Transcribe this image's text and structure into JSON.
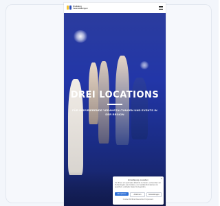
{
  "header": {
    "logo_text": "Dreiklang Veranstaltungen"
  },
  "hero": {
    "title": "DREI LOCATIONS",
    "subtitle": "FÜR INSPIRIERENDE VERANSTALTUNGEN UND EVENTS IN DER REGION"
  },
  "consent": {
    "title": "Einwilligung verwalten",
    "body": "Um Ihnen ein optimales Erlebnis zu bieten, verwenden wir Technologien wie Cookies, um Geräteinformationen zu speichern und/oder darauf zuzugreifen.",
    "accept_label": "Akzeptieren",
    "deny_label": "Ablehnen",
    "prefs_label": "Einstellungen",
    "links": "Cookie-Richtlinie  Datenschutz  Impressum"
  },
  "colors": {
    "hero_blue": "#2236a8",
    "accent_blue": "#2c6fd6",
    "logo_yellow": "#f2c12e",
    "logo_blue": "#2a4db8"
  }
}
